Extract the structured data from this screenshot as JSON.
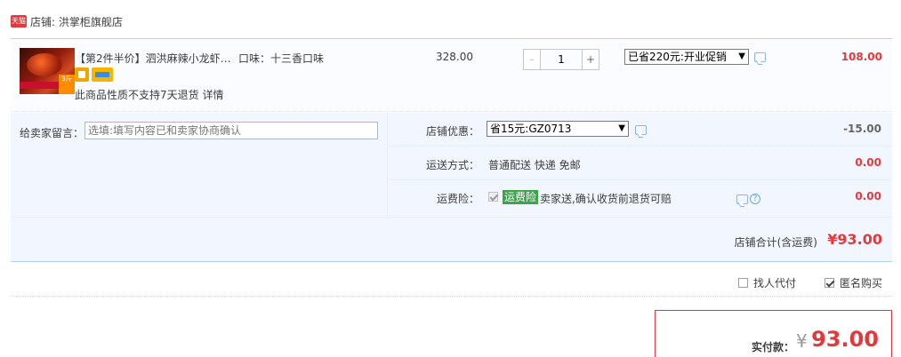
{
  "shop": {
    "badge": "天猫",
    "label": "店铺: 洪掌柜旗舰店"
  },
  "item": {
    "title": "【第2件半价】泗洪麻辣小龙虾4...",
    "spec": "口味：十三香口味",
    "thumb_text": "3斤",
    "notice": "此商品性质不支持7天退货 详情",
    "price": "328.00",
    "quantity": "1",
    "minus": "-",
    "plus": "+",
    "promo_selected": "已省220元:开业促销",
    "total": "108.00",
    "icons": [
      "guarantee-icon",
      "card-icon",
      "chat-icon"
    ]
  },
  "memo": {
    "label": "给卖家留言：",
    "placeholder": "选填:填写内容已和卖家协商确认"
  },
  "shop_discount": {
    "label": "店铺优惠：",
    "selected": "省15元:GZ0713",
    "amount": "-15.00"
  },
  "shipping": {
    "label": "运送方式：",
    "text": "普通配送 快递 免邮",
    "amount": "0.00"
  },
  "insurance": {
    "label": "运费险：",
    "tag": "运费险",
    "text": "卖家送,确认收货前退货可赔",
    "amount": "0.00",
    "help": "?"
  },
  "summary": {
    "label": "店铺合计(含运费)",
    "value": "¥93.00"
  },
  "options": {
    "proxy_pay": "找人代付",
    "anonymous": "匿名购买"
  },
  "payment": {
    "label": "实付款：",
    "currency": "¥",
    "value": "93.00"
  },
  "colors": {
    "accent_red": "#e4393c",
    "border_blue": "#b2d1ff",
    "panel_bg": "#f2f7ff",
    "insure_green": "#3fa34d"
  }
}
